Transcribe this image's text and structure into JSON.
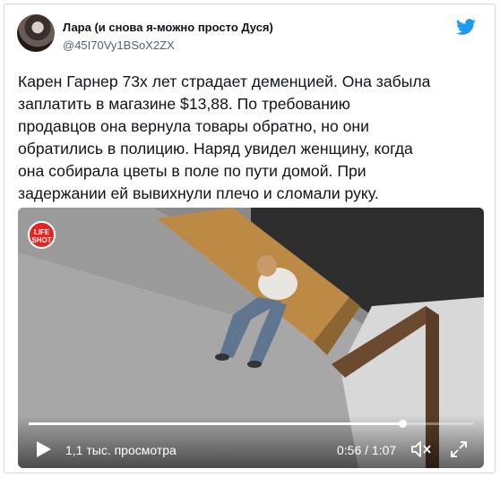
{
  "author": {
    "name": "Лара (и снова я-можно просто Дуся)",
    "handle": "@45I70Vy1BSoX2ZX"
  },
  "tweet": {
    "lines": [
      "Карен Гарнер 73х лет страдает деменцией. Она забыла",
      "заплатить в магазине $13,88. По требованию",
      "продавцов она вернула товары обратно, но они",
      "обратились в полицию. Наряд увидел женщину, когда",
      "она собирала цветы в поле по пути домой. При",
      "задержании ей вывихнули плечо и сломали руку."
    ]
  },
  "video": {
    "logo_top": "LIFE",
    "logo_bottom": "SHOT",
    "views": "1,1 тыс. просмотра",
    "time": "0:56 / 1:07",
    "progress": 0.84
  },
  "icons": {
    "brand": "twitter-bird-icon",
    "play": "play-icon",
    "mute": "volume-muted-icon",
    "fullscreen": "fullscreen-icon"
  },
  "colors": {
    "brand_blue": "#1d9bf0",
    "secondary_text": "#536471",
    "logo_red": "#e52421"
  }
}
